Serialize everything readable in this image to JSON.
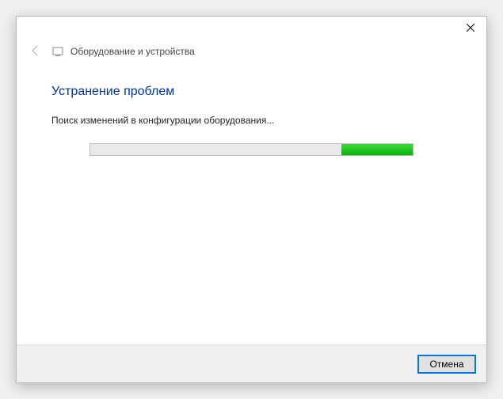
{
  "window": {
    "close_label": "Close"
  },
  "header": {
    "title": "Оборудование и устройства"
  },
  "main": {
    "heading": "Устранение проблем",
    "status": "Поиск изменений в конфигурации оборудования...",
    "progress_percent": 22
  },
  "footer": {
    "cancel_label": "Отмена"
  },
  "colors": {
    "accent": "#003399",
    "progress_green": "#06b106"
  }
}
